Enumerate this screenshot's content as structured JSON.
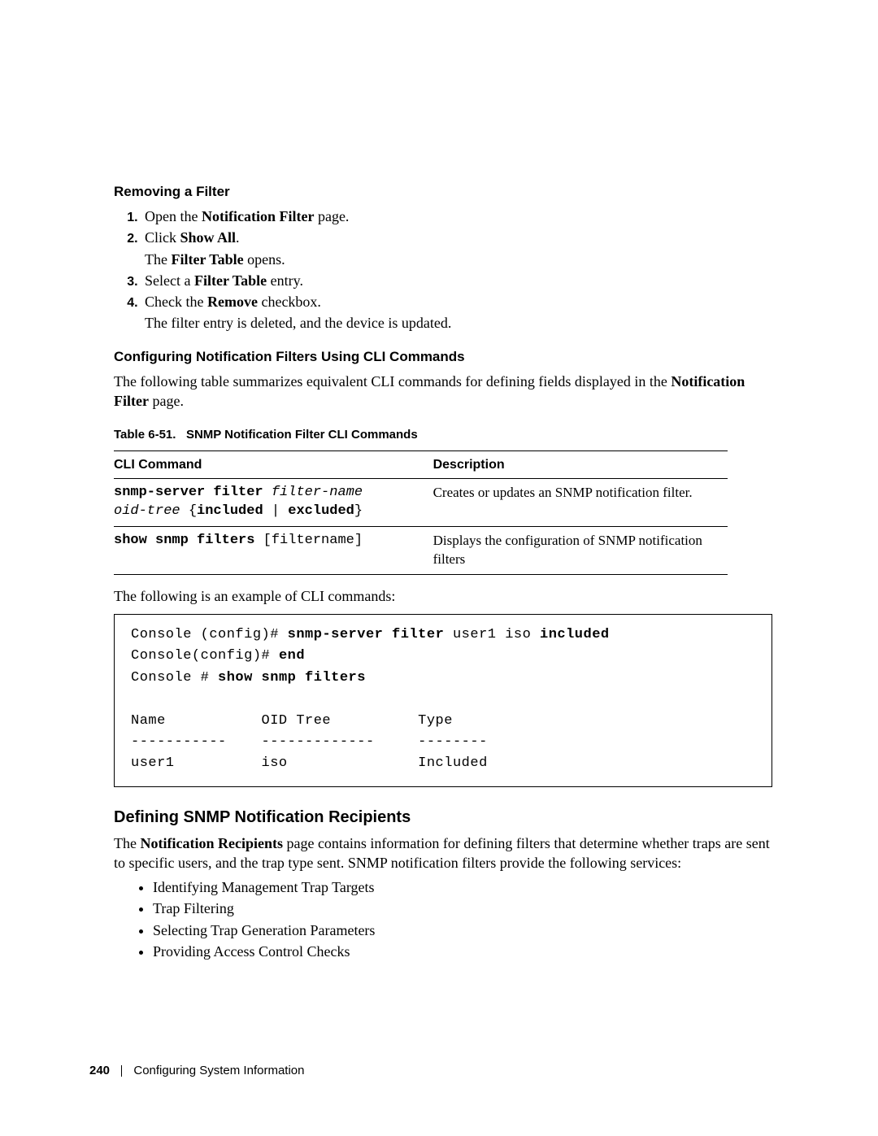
{
  "section1": {
    "heading": "Removing a Filter",
    "steps": [
      {
        "pre": "Open the ",
        "bold": "Notification Filter",
        "post": " page."
      },
      {
        "pre": "Click ",
        "bold": "Show All",
        "post": ".",
        "sub_pre": "The ",
        "sub_bold": "Filter Table",
        "sub_post": " opens."
      },
      {
        "pre": "Select a ",
        "bold": "Filter Table",
        "post": " entry."
      },
      {
        "pre": "Check the ",
        "bold": "Remove",
        "post": " checkbox.",
        "sub_plain": "The filter entry is deleted, and the device is updated."
      }
    ]
  },
  "section2": {
    "heading": "Configuring Notification Filters Using CLI Commands",
    "intro_pre": "The following table summarizes equivalent CLI commands for defining fields displayed in the ",
    "intro_bold": "Notification Filter",
    "intro_post": " page.",
    "table_caption_pre": "Table 6-51.",
    "table_caption_rest": "SNMP Notification Filter CLI Commands",
    "col1": "CLI Command",
    "col2": "Description",
    "rows": [
      {
        "cmd_b1": "snmp-server filter ",
        "cmd_i1": "filter-name oid-tree",
        "cmd_p1": " {",
        "cmd_b2": "included",
        "cmd_p2": " | ",
        "cmd_b3": "excluded",
        "cmd_p3": "}",
        "desc": "Creates or updates an SNMP notification filter."
      },
      {
        "cmd_b1": "show snmp filters ",
        "cmd_p1": "[filtername]",
        "desc": "Displays the configuration of SNMP notification filters"
      }
    ],
    "example_intro": "The following is an example of CLI commands:",
    "code": {
      "l1a": "Console (config)# ",
      "l1b": "snmp-server filter",
      "l1c": " user1 iso ",
      "l1d": "included",
      "l2a": "Console(config)# ",
      "l2b": "end",
      "l3a": "Console # ",
      "l3b": "show snmp filters",
      "l4": "",
      "l5": "Name           OID Tree          Type",
      "l6": "-----------    -------------     --------",
      "l7": "user1          iso               Included"
    }
  },
  "section3": {
    "heading": "Defining SNMP Notification Recipients",
    "intro_pre": "The ",
    "intro_bold": "Notification Recipients",
    "intro_post": " page contains information for defining filters that determine whether traps are sent to specific users, and the trap type sent. SNMP notification filters provide the following services:",
    "bullets": [
      "Identifying Management Trap Targets",
      "Trap Filtering",
      "Selecting Trap Generation Parameters",
      "Providing Access Control Checks"
    ]
  },
  "footer": {
    "page": "240",
    "chapter": "Configuring System Information"
  }
}
